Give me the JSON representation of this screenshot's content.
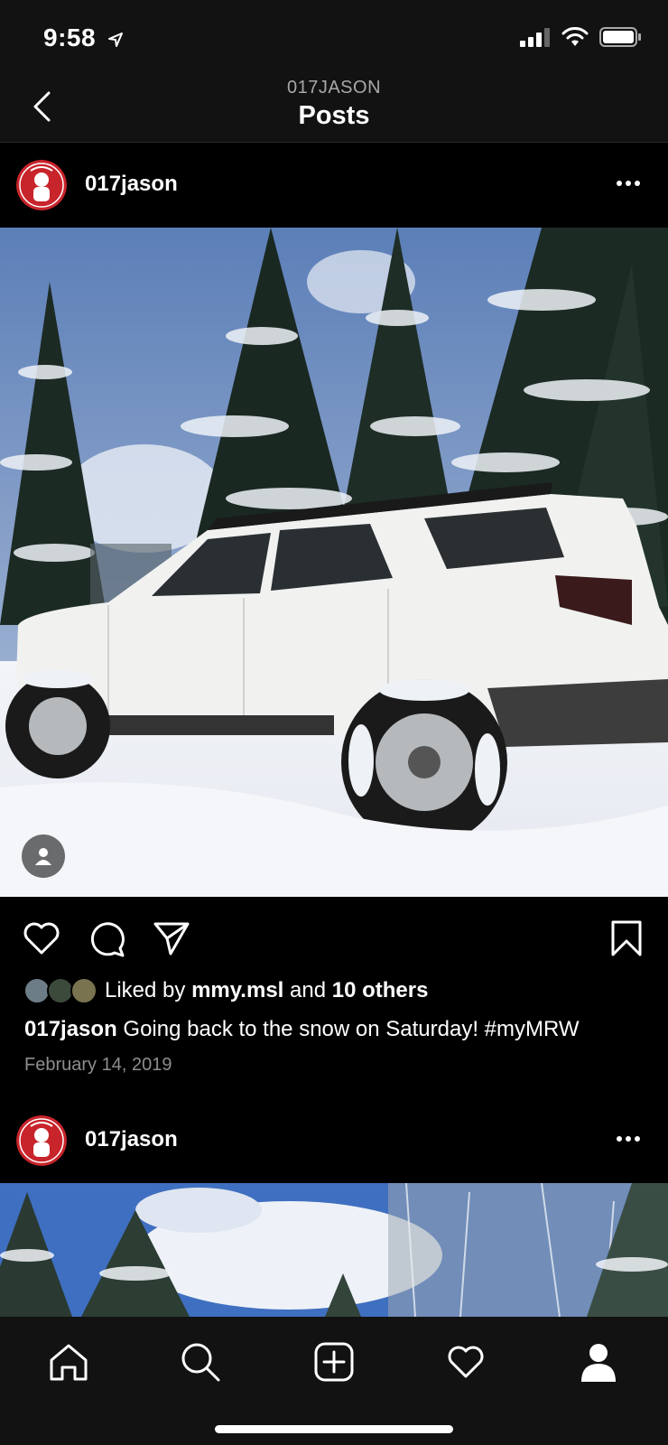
{
  "status_bar": {
    "time": "9:58"
  },
  "header": {
    "overline": "017JASON",
    "title": "Posts"
  },
  "posts": [
    {
      "username": "017jason",
      "liked_by_prefix": "Liked by",
      "liked_by_user": "mmy.msl",
      "liked_by_joiner": "and",
      "liked_by_others": "10 others",
      "caption_user": "017jason",
      "caption_text": "Going back to the snow on Saturday! #myMRW",
      "date": "February 14, 2019"
    },
    {
      "username": "017jason"
    }
  ],
  "tab_bar": {
    "items": [
      "home-icon",
      "search-icon",
      "new-post-icon",
      "activity-heart-icon",
      "profile-icon"
    ]
  },
  "colors": {
    "background": "#000000",
    "bar": "#121212",
    "muted": "#8e8e8e"
  }
}
